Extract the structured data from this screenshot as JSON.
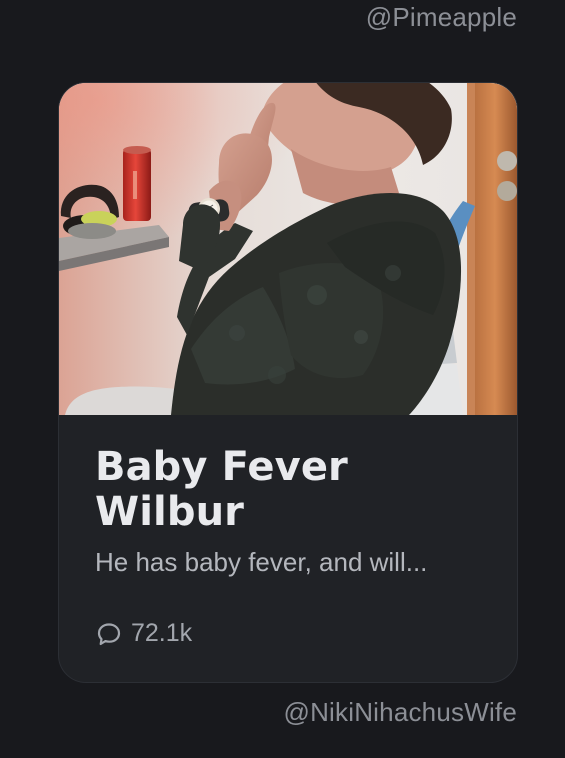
{
  "top_card": {
    "author": "@Pimeapple"
  },
  "story_card": {
    "title": "Baby Fever Wilbur",
    "description": "He has baby fever, and will...",
    "comment_count": "72.1k",
    "comment_icon": "comment-icon",
    "colors": {
      "card_background": "#202226",
      "title": "#e9eaed",
      "description": "#b4b7bd",
      "meta": "#a2a6ad"
    }
  },
  "next_card": {
    "author": "@NikiNihachusWife"
  }
}
